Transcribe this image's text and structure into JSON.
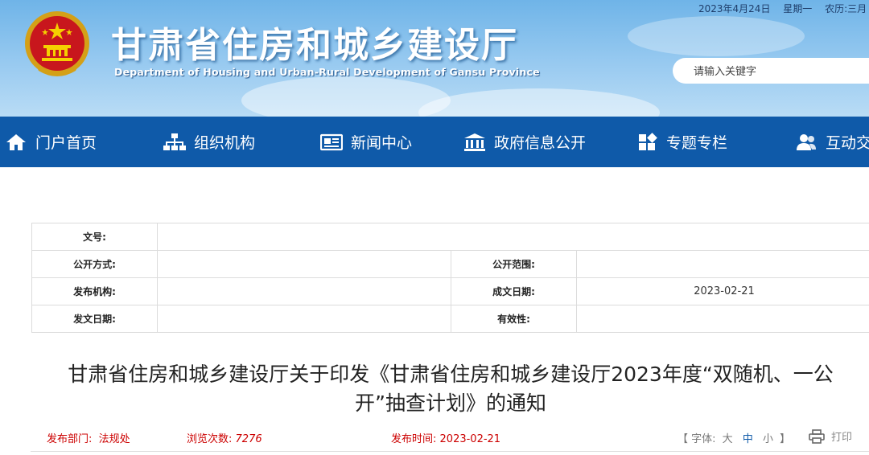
{
  "header": {
    "date": "2023年4月24日",
    "weekday": "星期一",
    "lunar": "农历:三月",
    "title": "甘肃省住房和城乡建设厅",
    "subtitle": "Department of Housing and Urban-Rural Development of Gansu Province",
    "search_placeholder": "请输入关键字"
  },
  "nav": {
    "items": [
      {
        "label": "门户首页",
        "icon": "home-icon"
      },
      {
        "label": "组织机构",
        "icon": "org-chart-icon"
      },
      {
        "label": "新闻中心",
        "icon": "news-icon"
      },
      {
        "label": "政府信息公开",
        "icon": "government-building-icon"
      },
      {
        "label": "专题专栏",
        "icon": "grid-icon"
      },
      {
        "label": "互动交",
        "icon": "users-icon"
      }
    ]
  },
  "meta": {
    "wenhao_label": "文号:",
    "gongkai_fangshi_label": "公开方式:",
    "gongkai_fanwei_label": "公开范围:",
    "fabu_jigou_label": "发布机构:",
    "chengwen_riqi_label": "成文日期:",
    "chengwen_riqi_value": "2023-02-21",
    "fawen_riqi_label": "发文日期:",
    "youxiaoxing_label": "有效性:"
  },
  "article": {
    "title_line1": "甘肃省住房和城乡建设厅关于印发《甘肃省住房和城乡建设厅2023年度“双随机、一公",
    "title_line2": "开”抽查计划》的通知",
    "dept_label": "发布部门:",
    "dept_value": "法规处",
    "views_label": "浏览次数:",
    "views_value": "7276",
    "time_label": "发布时间:",
    "time_value": "2023-02-21",
    "font_open": "【 字体:",
    "font_large": "大",
    "font_mid": "中",
    "font_small": "小",
    "font_close": "】",
    "print_label": "打印"
  },
  "colors": {
    "nav_bg": "#0f5aa9",
    "accent_red": "#cc0000"
  }
}
